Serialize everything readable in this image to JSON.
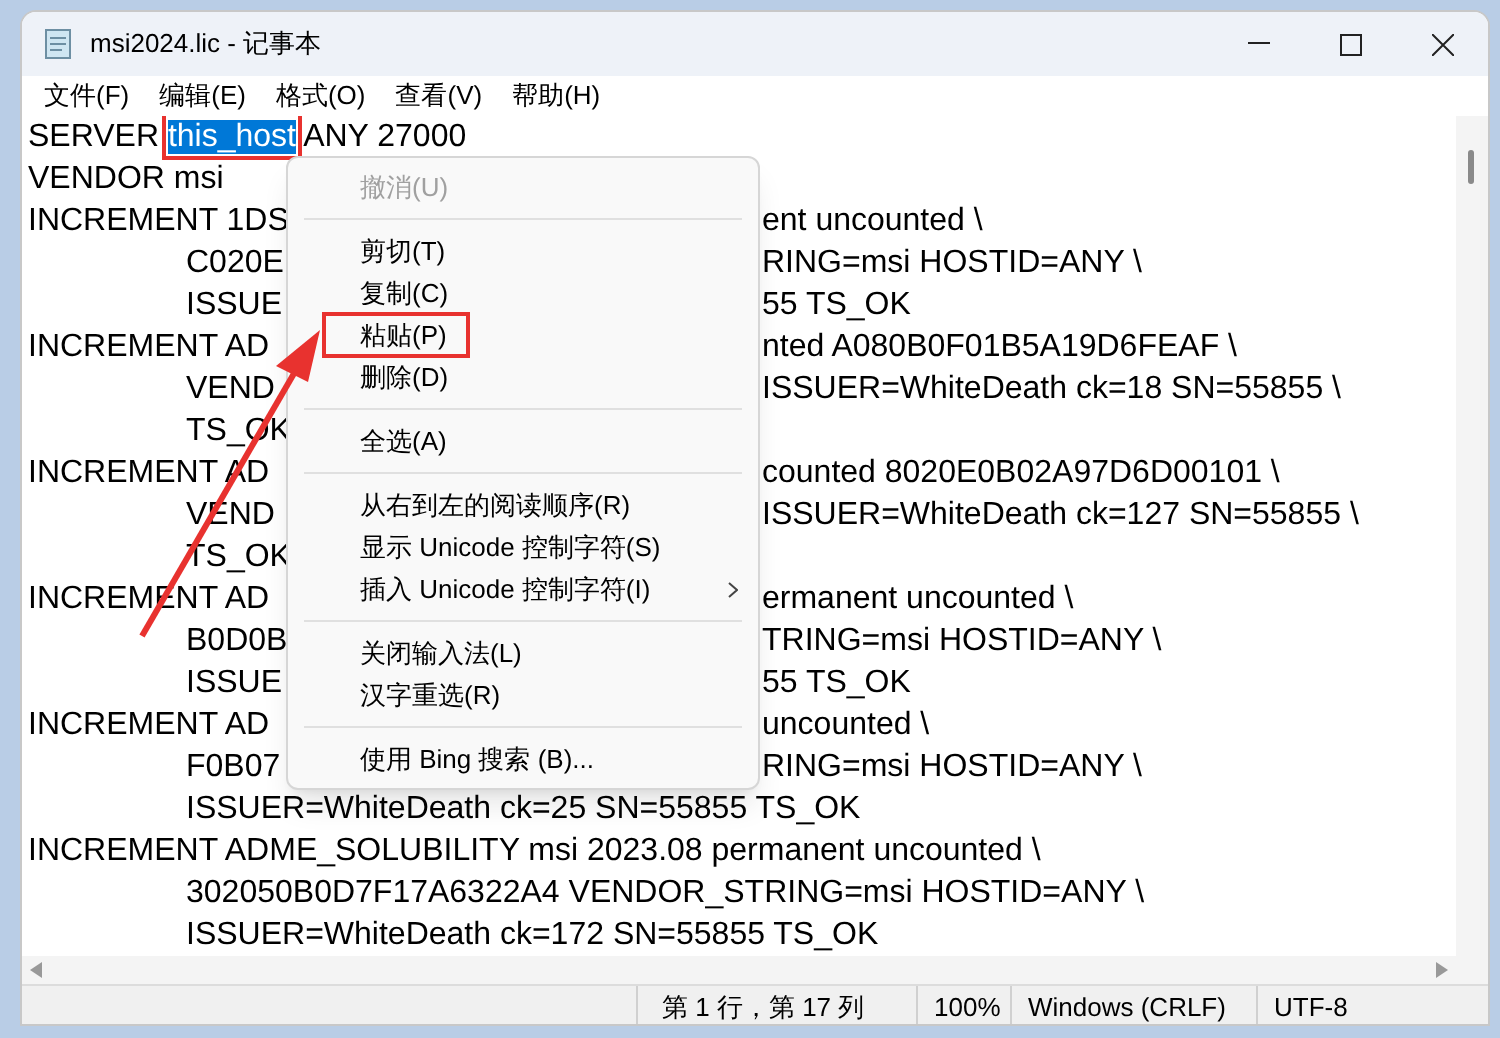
{
  "window": {
    "title": "msi2024.lic - 记事本"
  },
  "menu_bar": [
    "文件(F)",
    "编辑(E)",
    "格式(O)",
    "查看(V)",
    "帮助(H)"
  ],
  "editor": {
    "lines": [
      {
        "indented": false,
        "parts": [
          {
            "text": "SERVER ",
            "selected": false
          },
          {
            "text": "this_host",
            "selected": true,
            "highlighted": true
          },
          {
            "text": " ANY 27000",
            "selected": false
          }
        ]
      },
      {
        "indented": false,
        "left": "VENDOR msi"
      },
      {
        "indented": false,
        "left": "INCREMENT 1DS",
        "right": "ent uncounted \\"
      },
      {
        "indented": true,
        "left": "C020E",
        "right": "RING=msi HOSTID=ANY \\"
      },
      {
        "indented": true,
        "left": "ISSUE",
        "right": "55 TS_OK"
      },
      {
        "indented": false,
        "left": "INCREMENT AD",
        "right": "nted A080B0F01B5A19D6FEAF \\"
      },
      {
        "indented": true,
        "left": "VEND",
        "right": "ISSUER=WhiteDeath ck=18 SN=55855 \\"
      },
      {
        "indented": true,
        "left": "TS_OK"
      },
      {
        "indented": false,
        "left": "INCREMENT AD",
        "right": "counted 8020E0B02A97D6D00101 \\"
      },
      {
        "indented": true,
        "left": "VEND",
        "right": "ISSUER=WhiteDeath ck=127 SN=55855 \\"
      },
      {
        "indented": true,
        "left": "TS_OK"
      },
      {
        "indented": false,
        "left": "INCREMENT AD",
        "right": "ermanent uncounted \\"
      },
      {
        "indented": true,
        "left": "B0D0B",
        "right": "TRING=msi HOSTID=ANY \\"
      },
      {
        "indented": true,
        "left": "ISSUE",
        "right": "55 TS_OK"
      },
      {
        "indented": false,
        "left": "INCREMENT AD",
        "right": "uncounted \\"
      },
      {
        "indented": true,
        "left": "F0B07",
        "right": "RING=msi HOSTID=ANY \\"
      },
      {
        "indented": true,
        "left": "ISSUER=WhiteDeath ck=25 SN=55855 TS_OK"
      },
      {
        "indented": false,
        "left": "INCREMENT ADME_SOLUBILITY msi 2023.08 permanent uncounted \\"
      },
      {
        "indented": true,
        "left": "302050B0D7F17A6322A4 VENDOR_STRING=msi HOSTID=ANY \\"
      },
      {
        "indented": true,
        "left": "ISSUER=WhiteDeath ck=172 SN=55855 TS_OK"
      }
    ]
  },
  "context_menu": [
    {
      "kind": "item",
      "label": "撤消(U)",
      "disabled": true,
      "submenu": false,
      "highlighted": false
    },
    {
      "kind": "separator"
    },
    {
      "kind": "item",
      "label": "剪切(T)",
      "disabled": false,
      "submenu": false,
      "highlighted": false
    },
    {
      "kind": "item",
      "label": "复制(C)",
      "disabled": false,
      "submenu": false,
      "highlighted": false
    },
    {
      "kind": "item",
      "label": "粘贴(P)",
      "disabled": false,
      "submenu": false,
      "highlighted": true
    },
    {
      "kind": "item",
      "label": "删除(D)",
      "disabled": false,
      "submenu": false,
      "highlighted": false
    },
    {
      "kind": "separator"
    },
    {
      "kind": "item",
      "label": "全选(A)",
      "disabled": false,
      "submenu": false,
      "highlighted": false
    },
    {
      "kind": "separator"
    },
    {
      "kind": "item",
      "label": "从右到左的阅读顺序(R)",
      "disabled": false,
      "submenu": false,
      "highlighted": false
    },
    {
      "kind": "item",
      "label": "显示 Unicode 控制字符(S)",
      "disabled": false,
      "submenu": false,
      "highlighted": false
    },
    {
      "kind": "item",
      "label": "插入 Unicode 控制字符(I)",
      "disabled": false,
      "submenu": true,
      "highlighted": false
    },
    {
      "kind": "separator"
    },
    {
      "kind": "item",
      "label": "关闭输入法(L)",
      "disabled": false,
      "submenu": false,
      "highlighted": false
    },
    {
      "kind": "item",
      "label": "汉字重选(R)",
      "disabled": false,
      "submenu": false,
      "highlighted": false
    },
    {
      "kind": "separator"
    },
    {
      "kind": "item",
      "label": "使用 Bing 搜索 (B)...",
      "disabled": false,
      "submenu": false,
      "highlighted": false
    }
  ],
  "status_bar": {
    "position": "第 1 行，第 17 列",
    "zoom": "100%",
    "line_ending": "Windows (CRLF)",
    "encoding": "UTF-8"
  }
}
